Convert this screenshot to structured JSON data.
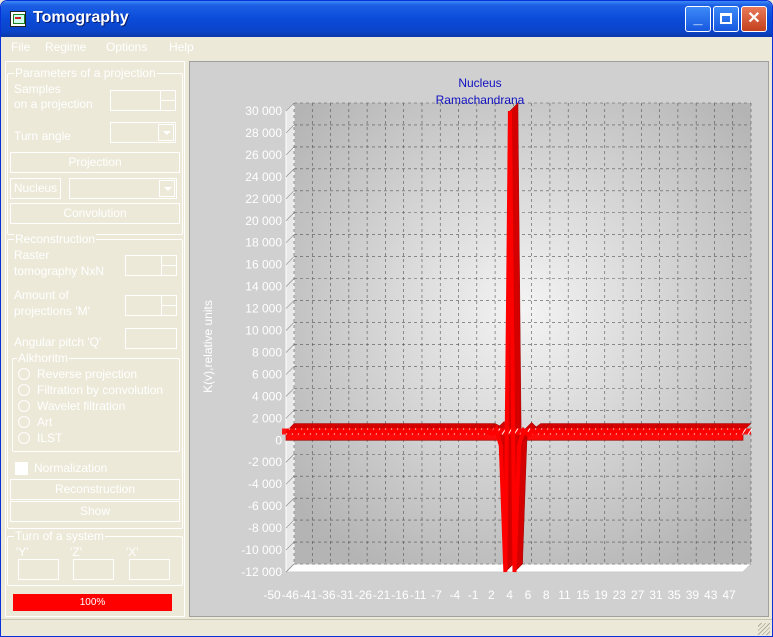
{
  "window": {
    "title": "Tomography"
  },
  "menu": [
    "File",
    "Regime",
    "Options",
    "Help"
  ],
  "projection_group": {
    "title": "Parameters of a projection",
    "samples_label_1": "Samples",
    "samples_label_2": "on a projection",
    "turn_angle_label": "Turn angle",
    "projection_button": "Projection",
    "nucleus_button": "Nucleus",
    "convolution_button": "Convolution"
  },
  "reconstruction_group": {
    "title": "Reconstruction",
    "raster_label_1": "Raster",
    "raster_label_2": "tomography NxN",
    "amount_label_1": "Amount of",
    "amount_label_2": "projections 'M'",
    "angular_label": "Angular pitch 'Q'",
    "algorithm_title": "Alkhoritm",
    "algorithms": [
      "Reverse projection",
      "Filtration by convolution",
      "Wavelet filtration",
      "Art",
      "ILST"
    ],
    "normalization_label": "Normalization",
    "reconstruction_button": "Reconstruction",
    "show_button": "Show"
  },
  "turn_group": {
    "title": "Turn of a system",
    "labels": [
      "'Y'",
      "'Z'",
      "'X'"
    ]
  },
  "progress": {
    "label": "100%",
    "value": 1.0,
    "color": "#ff0000"
  },
  "chart_data": {
    "type": "area",
    "title": "Nucleus",
    "subtitle": "Ramachandrana",
    "ylabel": "K(v),relative units",
    "xlabel": "",
    "ylim": [
      -12000,
      30000
    ],
    "yticks": [
      "30 000",
      "28 000",
      "26 000",
      "24 000",
      "22 000",
      "20 000",
      "18 000",
      "16 000",
      "14 000",
      "12 000",
      "10 000",
      "8 000",
      "6 000",
      "4 000",
      "2 000",
      "0",
      "-2 000",
      "-4 000",
      "-6 000",
      "-8 000",
      "-10 000",
      "-12 000"
    ],
    "xticks": [
      "-50",
      "-46",
      "-41",
      "-36",
      "-31",
      "-26",
      "-21",
      "-16",
      "-11",
      "-7",
      "-4",
      "-1",
      "2",
      "4",
      "6",
      "8",
      "11",
      "15",
      "19",
      "23",
      "27",
      "31",
      "35",
      "39",
      "43",
      "47"
    ],
    "series": [
      {
        "color": "#ff0000",
        "x": [
          -50,
          -40,
          -30,
          -20,
          -10,
          -6,
          -5,
          -4,
          -3,
          -2,
          -1,
          0,
          1,
          2,
          3,
          4,
          5,
          6,
          10,
          20,
          30,
          40,
          50
        ],
        "y": [
          800,
          800,
          800,
          800,
          800,
          800,
          600,
          1000,
          -500,
          -12000,
          30000,
          -12000,
          -400,
          900,
          500,
          800,
          800,
          800,
          800,
          800,
          800,
          800,
          800
        ]
      }
    ],
    "grid": true
  }
}
